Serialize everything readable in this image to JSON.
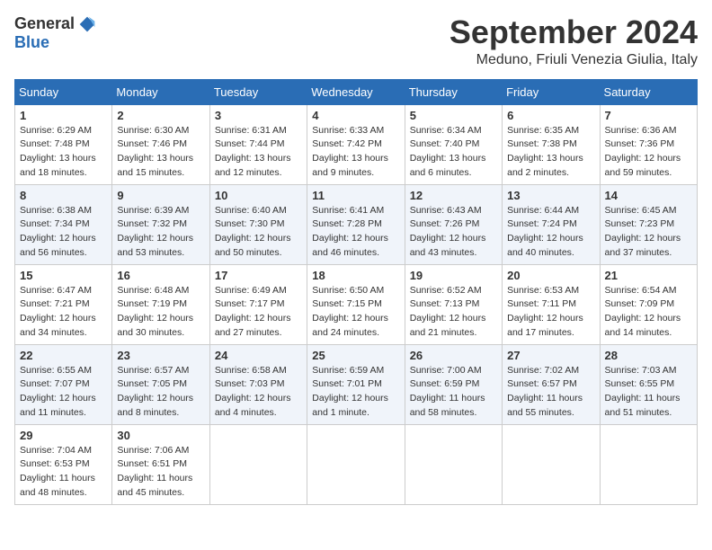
{
  "header": {
    "logo_general": "General",
    "logo_blue": "Blue",
    "month_title": "September 2024",
    "location": "Meduno, Friuli Venezia Giulia, Italy"
  },
  "weekdays": [
    "Sunday",
    "Monday",
    "Tuesday",
    "Wednesday",
    "Thursday",
    "Friday",
    "Saturday"
  ],
  "weeks": [
    [
      {
        "day": "1",
        "sunrise": "6:29 AM",
        "sunset": "7:48 PM",
        "daylight": "13 hours and 18 minutes."
      },
      {
        "day": "2",
        "sunrise": "6:30 AM",
        "sunset": "7:46 PM",
        "daylight": "13 hours and 15 minutes."
      },
      {
        "day": "3",
        "sunrise": "6:31 AM",
        "sunset": "7:44 PM",
        "daylight": "13 hours and 12 minutes."
      },
      {
        "day": "4",
        "sunrise": "6:33 AM",
        "sunset": "7:42 PM",
        "daylight": "13 hours and 9 minutes."
      },
      {
        "day": "5",
        "sunrise": "6:34 AM",
        "sunset": "7:40 PM",
        "daylight": "13 hours and 6 minutes."
      },
      {
        "day": "6",
        "sunrise": "6:35 AM",
        "sunset": "7:38 PM",
        "daylight": "13 hours and 2 minutes."
      },
      {
        "day": "7",
        "sunrise": "6:36 AM",
        "sunset": "7:36 PM",
        "daylight": "12 hours and 59 minutes."
      }
    ],
    [
      {
        "day": "8",
        "sunrise": "6:38 AM",
        "sunset": "7:34 PM",
        "daylight": "12 hours and 56 minutes."
      },
      {
        "day": "9",
        "sunrise": "6:39 AM",
        "sunset": "7:32 PM",
        "daylight": "12 hours and 53 minutes."
      },
      {
        "day": "10",
        "sunrise": "6:40 AM",
        "sunset": "7:30 PM",
        "daylight": "12 hours and 50 minutes."
      },
      {
        "day": "11",
        "sunrise": "6:41 AM",
        "sunset": "7:28 PM",
        "daylight": "12 hours and 46 minutes."
      },
      {
        "day": "12",
        "sunrise": "6:43 AM",
        "sunset": "7:26 PM",
        "daylight": "12 hours and 43 minutes."
      },
      {
        "day": "13",
        "sunrise": "6:44 AM",
        "sunset": "7:24 PM",
        "daylight": "12 hours and 40 minutes."
      },
      {
        "day": "14",
        "sunrise": "6:45 AM",
        "sunset": "7:23 PM",
        "daylight": "12 hours and 37 minutes."
      }
    ],
    [
      {
        "day": "15",
        "sunrise": "6:47 AM",
        "sunset": "7:21 PM",
        "daylight": "12 hours and 34 minutes."
      },
      {
        "day": "16",
        "sunrise": "6:48 AM",
        "sunset": "7:19 PM",
        "daylight": "12 hours and 30 minutes."
      },
      {
        "day": "17",
        "sunrise": "6:49 AM",
        "sunset": "7:17 PM",
        "daylight": "12 hours and 27 minutes."
      },
      {
        "day": "18",
        "sunrise": "6:50 AM",
        "sunset": "7:15 PM",
        "daylight": "12 hours and 24 minutes."
      },
      {
        "day": "19",
        "sunrise": "6:52 AM",
        "sunset": "7:13 PM",
        "daylight": "12 hours and 21 minutes."
      },
      {
        "day": "20",
        "sunrise": "6:53 AM",
        "sunset": "7:11 PM",
        "daylight": "12 hours and 17 minutes."
      },
      {
        "day": "21",
        "sunrise": "6:54 AM",
        "sunset": "7:09 PM",
        "daylight": "12 hours and 14 minutes."
      }
    ],
    [
      {
        "day": "22",
        "sunrise": "6:55 AM",
        "sunset": "7:07 PM",
        "daylight": "12 hours and 11 minutes."
      },
      {
        "day": "23",
        "sunrise": "6:57 AM",
        "sunset": "7:05 PM",
        "daylight": "12 hours and 8 minutes."
      },
      {
        "day": "24",
        "sunrise": "6:58 AM",
        "sunset": "7:03 PM",
        "daylight": "12 hours and 4 minutes."
      },
      {
        "day": "25",
        "sunrise": "6:59 AM",
        "sunset": "7:01 PM",
        "daylight": "12 hours and 1 minute."
      },
      {
        "day": "26",
        "sunrise": "7:00 AM",
        "sunset": "6:59 PM",
        "daylight": "11 hours and 58 minutes."
      },
      {
        "day": "27",
        "sunrise": "7:02 AM",
        "sunset": "6:57 PM",
        "daylight": "11 hours and 55 minutes."
      },
      {
        "day": "28",
        "sunrise": "7:03 AM",
        "sunset": "6:55 PM",
        "daylight": "11 hours and 51 minutes."
      }
    ],
    [
      {
        "day": "29",
        "sunrise": "7:04 AM",
        "sunset": "6:53 PM",
        "daylight": "11 hours and 48 minutes."
      },
      {
        "day": "30",
        "sunrise": "7:06 AM",
        "sunset": "6:51 PM",
        "daylight": "11 hours and 45 minutes."
      },
      null,
      null,
      null,
      null,
      null
    ]
  ]
}
